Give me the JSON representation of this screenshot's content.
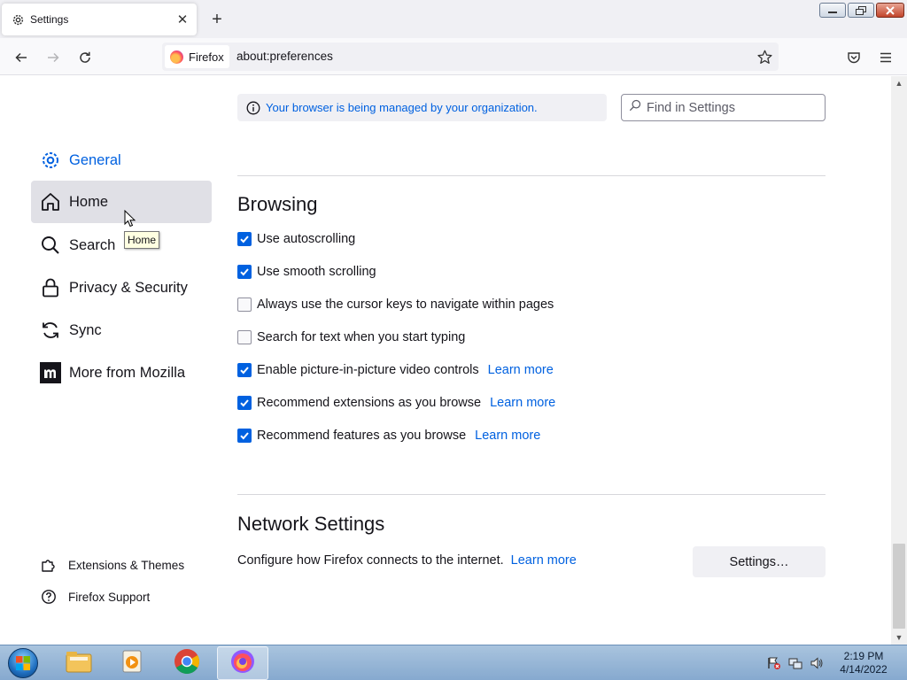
{
  "browser": {
    "tab": {
      "title": "Settings",
      "icon": "gear-icon"
    },
    "identity_label": "Firefox",
    "url": "about:preferences"
  },
  "sidebar": {
    "items": [
      {
        "label": "General",
        "icon": "gear-icon",
        "selected": true
      },
      {
        "label": "Home",
        "icon": "home-icon",
        "hovered": true
      },
      {
        "label": "Search",
        "icon": "search-icon"
      },
      {
        "label": "Privacy & Security",
        "icon": "lock-icon"
      },
      {
        "label": "Sync",
        "icon": "sync-icon"
      },
      {
        "label": "More from Mozilla",
        "icon": "mozilla-icon"
      }
    ],
    "tooltip": "Home",
    "footer": [
      {
        "label": "Extensions & Themes",
        "icon": "puzzle-icon"
      },
      {
        "label": "Firefox Support",
        "icon": "help-icon"
      }
    ]
  },
  "main": {
    "policy_notice": "Your browser is being managed by your organization.",
    "search_placeholder": "Find in Settings",
    "browsing": {
      "heading": "Browsing",
      "options": [
        {
          "label": "Use autoscrolling",
          "checked": true
        },
        {
          "label": "Use smooth scrolling",
          "checked": true
        },
        {
          "label": "Always use the cursor keys to navigate within pages",
          "checked": false
        },
        {
          "label": "Search for text when you start typing",
          "checked": false
        },
        {
          "label": "Enable picture-in-picture video controls",
          "checked": true,
          "link": "Learn more"
        },
        {
          "label": "Recommend extensions as you browse",
          "checked": true,
          "link": "Learn more"
        },
        {
          "label": "Recommend features as you browse",
          "checked": true,
          "link": "Learn more"
        }
      ]
    },
    "network": {
      "heading": "Network Settings",
      "description": "Configure how Firefox connects to the internet.",
      "link": "Learn more",
      "button": "Settings…"
    }
  },
  "taskbar": {
    "apps": [
      "explorer-icon",
      "media-player-icon",
      "chrome-icon",
      "firefox-icon"
    ],
    "clock": {
      "time": "2:19 PM",
      "date": "4/14/2022"
    }
  },
  "colors": {
    "accent": "#0061e0",
    "hover_bg": "#e0e0e6",
    "tooltip_bg": "#ffffe1"
  }
}
